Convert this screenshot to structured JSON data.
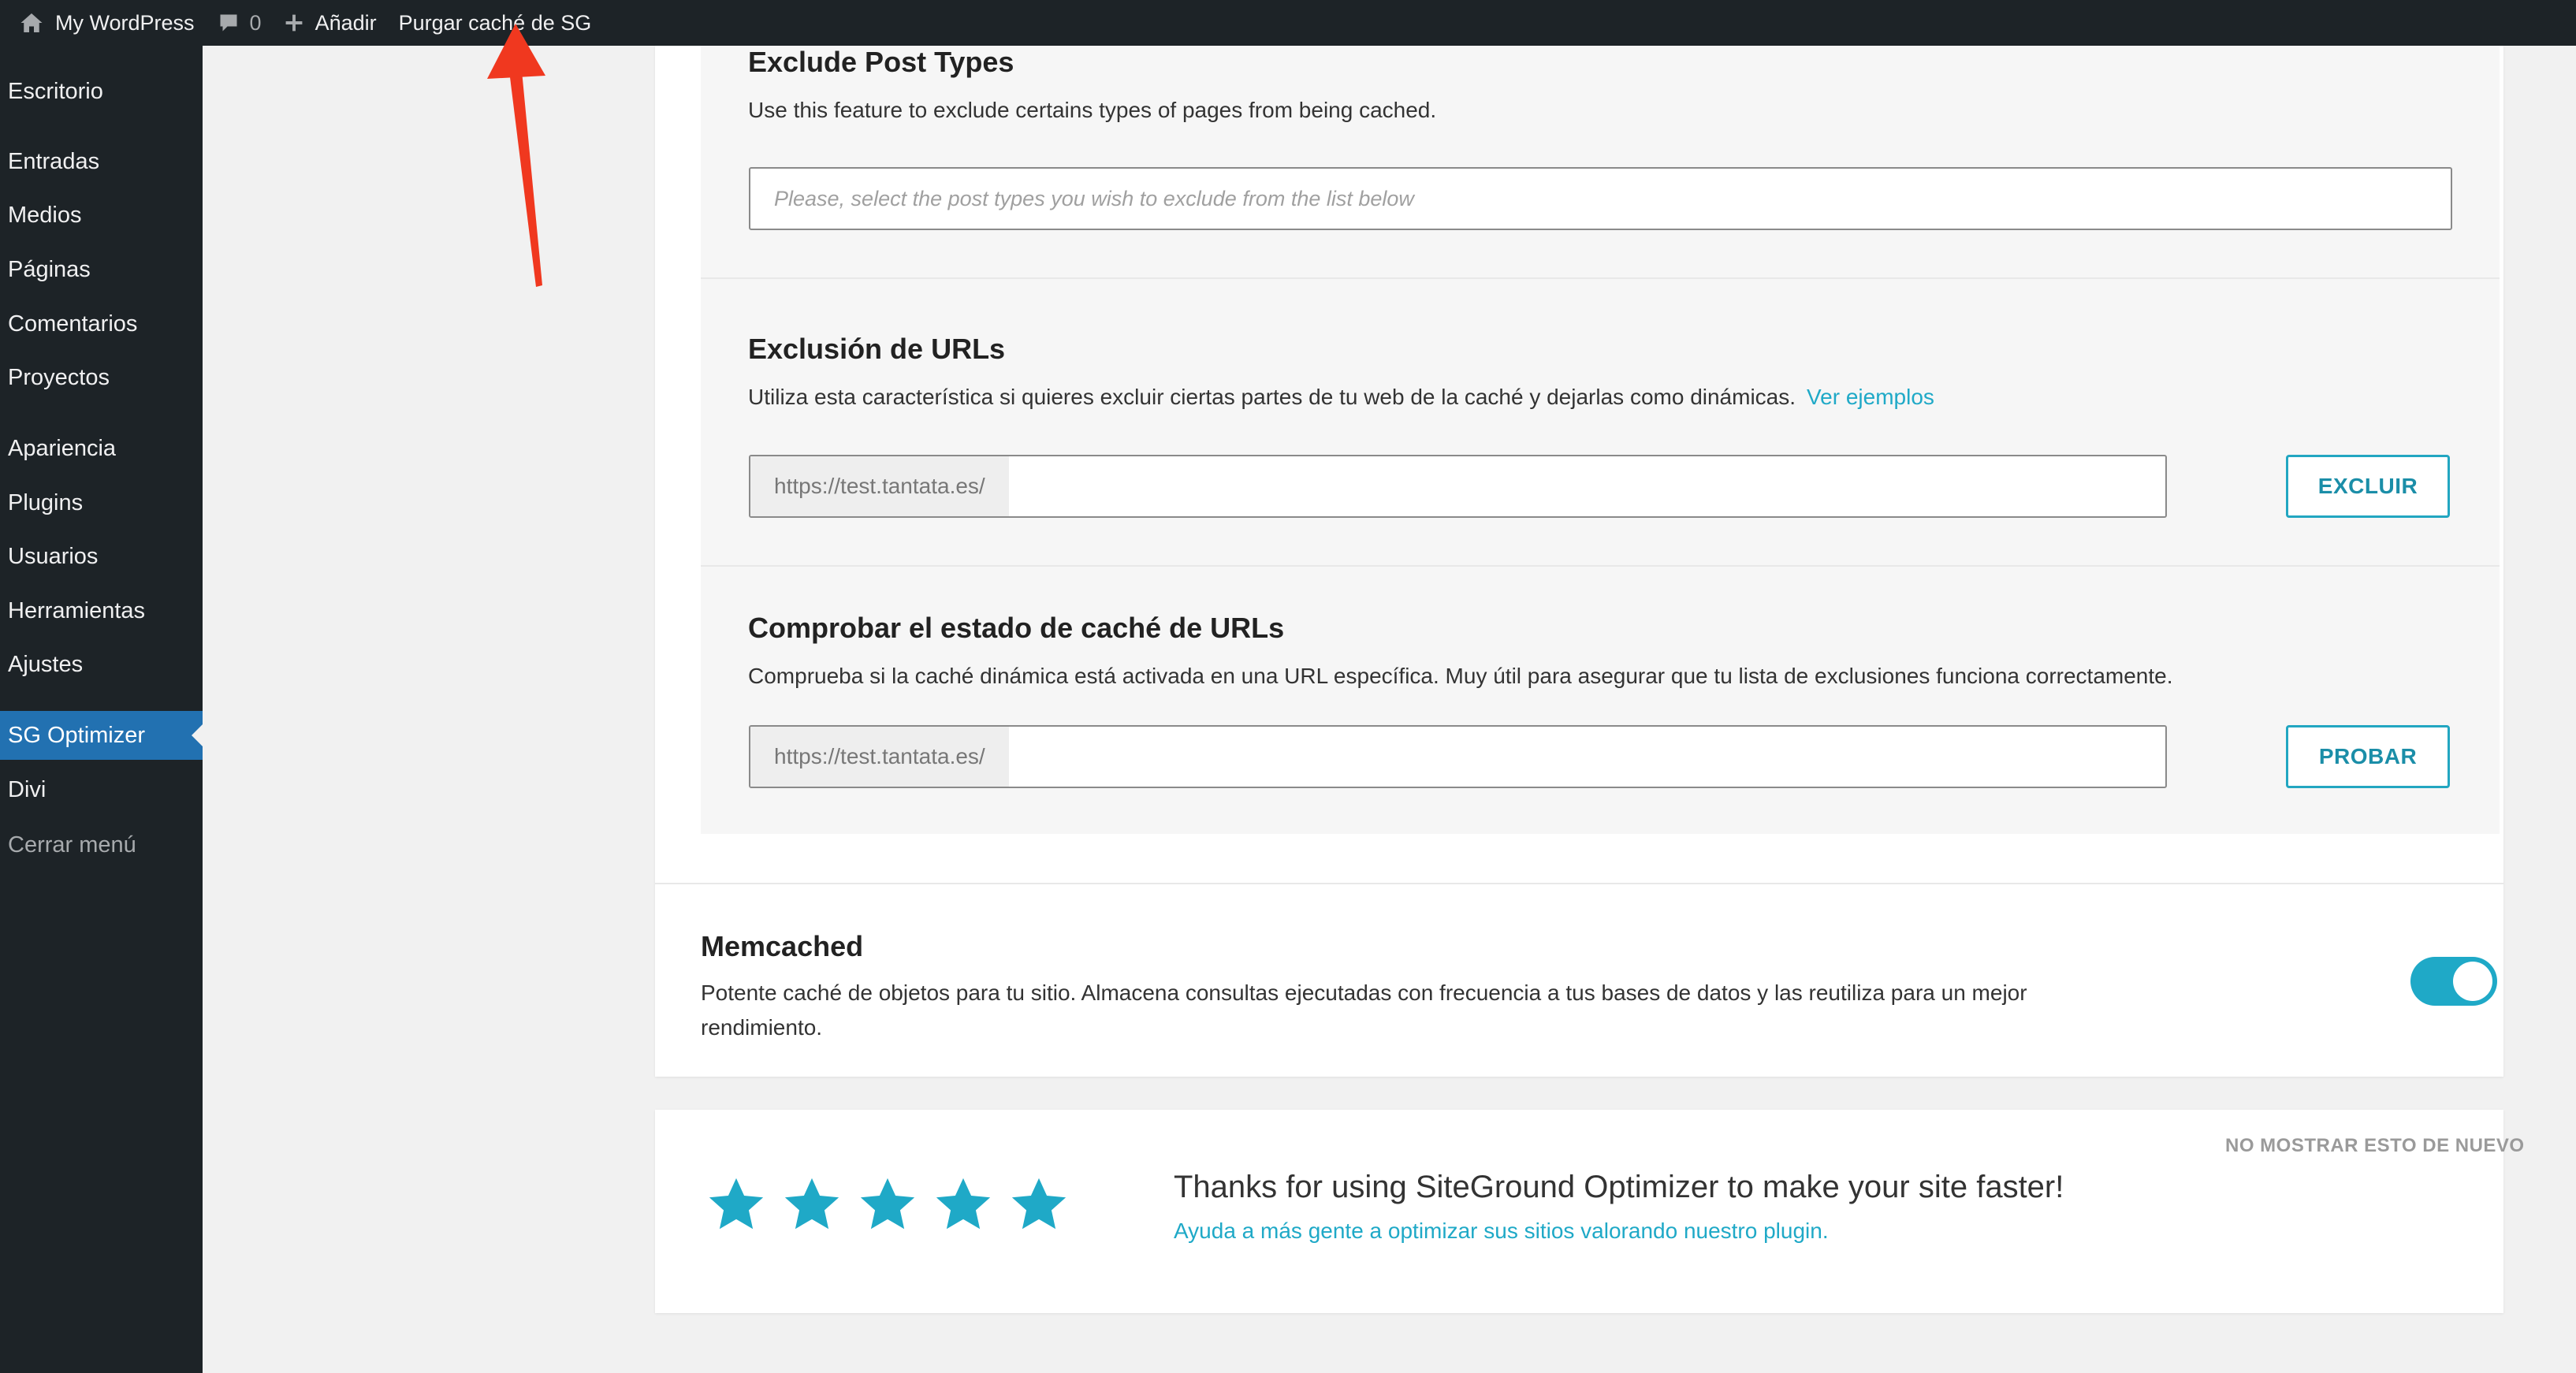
{
  "adminbar": {
    "site_name": "My WordPress",
    "comments_count": "0",
    "new_label": "Añadir",
    "purge_label": "Purgar caché de SG"
  },
  "sidebar": {
    "items": [
      {
        "label": "Escritorio"
      },
      {
        "label": "Entradas"
      },
      {
        "label": "Medios"
      },
      {
        "label": "Páginas"
      },
      {
        "label": "Comentarios"
      },
      {
        "label": "Proyectos"
      },
      {
        "label": "Apariencia"
      },
      {
        "label": "Plugins"
      },
      {
        "label": "Usuarios"
      },
      {
        "label": "Herramientas"
      },
      {
        "label": "Ajustes"
      },
      {
        "label": "SG Optimizer"
      },
      {
        "label": "Divi"
      },
      {
        "label": "Cerrar menú"
      }
    ],
    "current": "SG Optimizer"
  },
  "exclude_post_types": {
    "title": "Exclude Post Types",
    "description": "Use this feature to exclude certains types of pages from being cached.",
    "placeholder": "Please, select the post types you wish to exclude from the list below"
  },
  "url_exclusion": {
    "title": "Exclusión de URLs",
    "description": "Utiliza esta característica si quieres excluir ciertas partes de tu web de la caché y dejarlas como dinámicas.",
    "link": "Ver ejemplos",
    "prefix": "https://test.tantata.es/",
    "button": "EXCLUIR"
  },
  "url_check": {
    "title": "Comprobar el estado de caché de URLs",
    "description": "Comprueba si la caché dinámica está activada en una URL específica. Muy útil para asegurar que tu lista de exclusiones funciona correctamente.",
    "prefix": "https://test.tantata.es/",
    "button": "PROBAR"
  },
  "memcached": {
    "title": "Memcached",
    "description_line1": "Potente caché de objetos para tu sitio. Almacena consultas ejecutadas con frecuencia a tus bases de datos y las reutiliza para un mejor",
    "description_line2": "rendimiento.",
    "enabled": true
  },
  "rating": {
    "dismiss": "NO MOSTRAR ESTO DE NUEVO",
    "thanks": "Thanks for using SiteGround Optimizer to make your site faster!",
    "link": "Ayuda a más gente a optimizar sus sitios valorando nuestro plugin.",
    "stars": 5
  },
  "colors": {
    "accent": "#1fa9c7",
    "adminbar": "#1d2327",
    "menu_current": "#2271b1",
    "annotation_arrow": "#f0381f"
  }
}
